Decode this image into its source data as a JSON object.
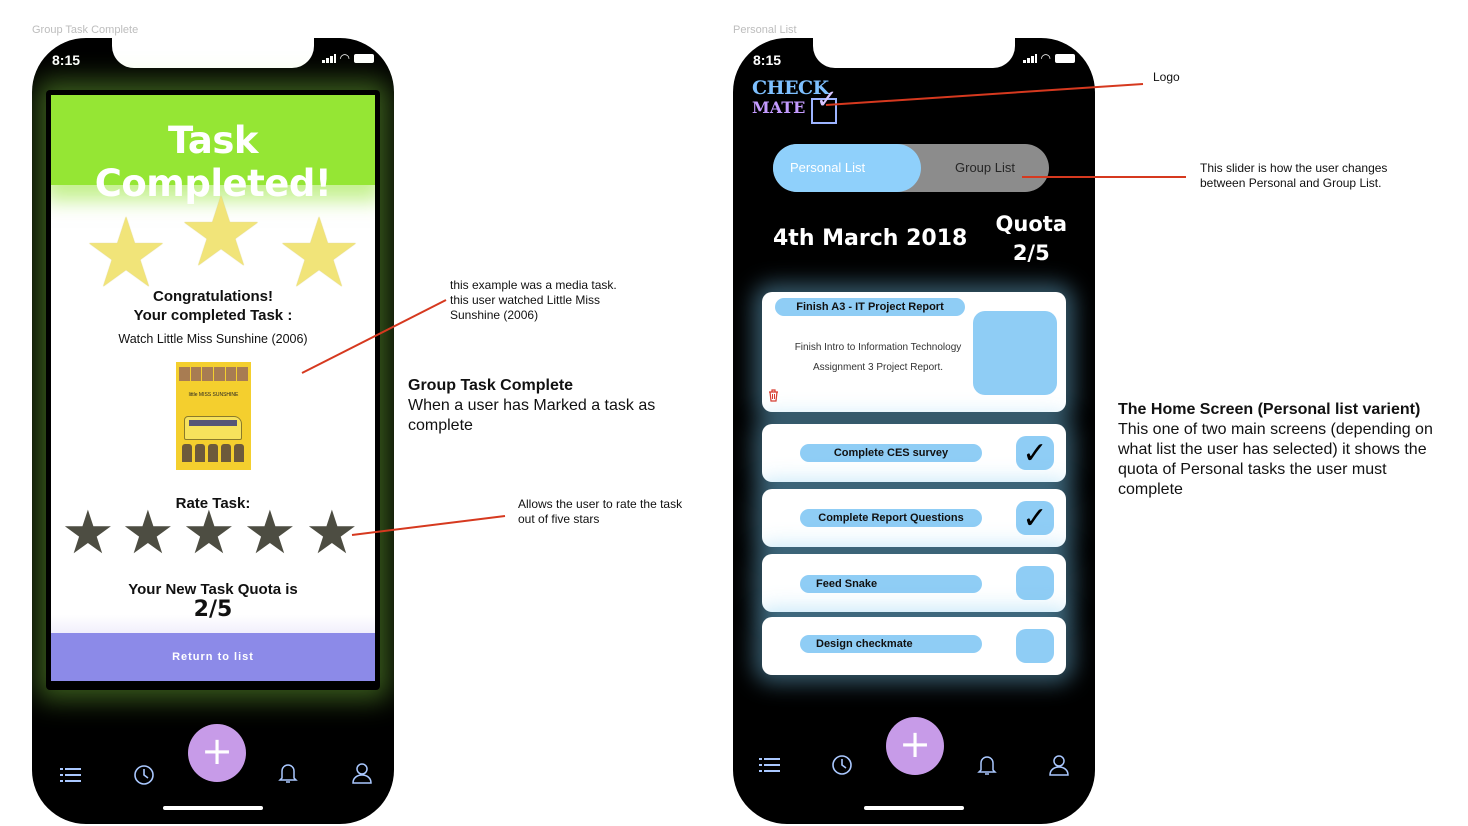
{
  "frames": {
    "left_label": "Group Task Complete",
    "right_label": "Personal List"
  },
  "status": {
    "time": "8:15"
  },
  "task_complete_screen": {
    "title": "Task Completed!",
    "congrats_line1": "Congratulations!",
    "congrats_line2": "Your completed Task :",
    "task_name": "Watch Little Miss Sunshine (2006)",
    "poster_title": "little MISS SUNSHINE",
    "rate_label": "Rate Task:",
    "quota_label": "Your New Task Quota is",
    "quota_value": "2/5",
    "return_button": "Return to list",
    "reward_stars": 3,
    "rating_stars": 5
  },
  "home_screen": {
    "logo_line1": "CHECK",
    "logo_line2": "MATE",
    "toggle_active": "Personal List",
    "toggle_inactive": "Group List",
    "date": "4th March 2018",
    "quota_label": "Quota",
    "quota_value": "2/5",
    "tasks": [
      {
        "title": "Finish A3 - IT Project Report",
        "description": "Finish Intro to Information Technology Assignment 3 Project Report.",
        "checked": false
      },
      {
        "title": "Complete CES survey",
        "checked": true
      },
      {
        "title": "Complete Report Questions",
        "checked": true
      },
      {
        "title": "Feed Snake",
        "checked": false
      },
      {
        "title": "Design checkmate",
        "checked": false
      }
    ]
  },
  "tabbar": {
    "icons": [
      "list-icon",
      "clock-icon",
      "add-icon",
      "bell-icon",
      "profile-icon"
    ],
    "add_glyph": "+"
  },
  "annotations": {
    "media_note": "this example was a media task. this user watched Little Miss Sunshine (2006)",
    "rate_note": "Allows the user to rate the task out of five stars",
    "group_heading": "Group Task Complete",
    "group_desc": "When a user has Marked a task as complete",
    "logo_note": "Logo",
    "slider_note": "This slider is how the user changes between Personal and Group List.",
    "home_heading": "The Home Screen (Personal list varient)",
    "home_desc": "This one of two main screens (depending on what list the user has selected) it shows the  quota of Personal tasks the user must complete"
  },
  "colors": {
    "header_green": "#95e634",
    "return_purple": "#8c8ae8",
    "accent_blue": "#8fd0fb",
    "fab_purple": "#c79be8",
    "annotation_red": "#d6391f"
  }
}
